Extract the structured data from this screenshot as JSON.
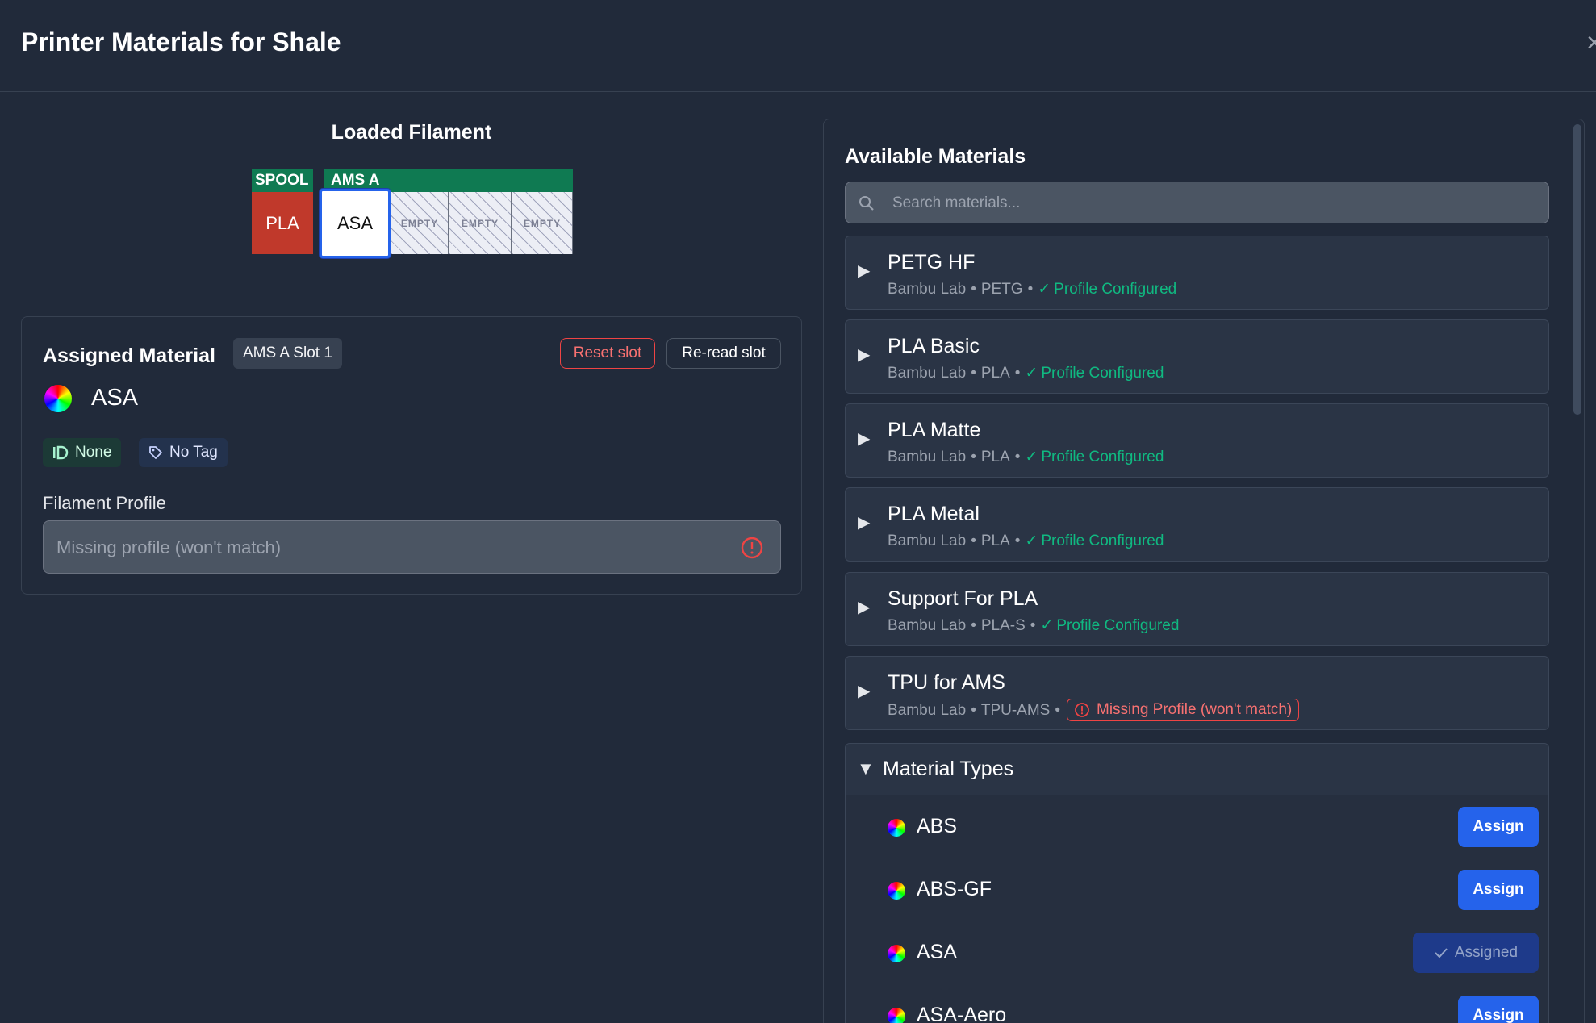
{
  "dialog": {
    "title": "Printer Materials for Shale",
    "close_glyph": "×"
  },
  "loaded_filament": {
    "title": "Loaded Filament",
    "spool_label": "SPOOL",
    "ams_label": "AMS A",
    "spool_slot": {
      "material": "PLA",
      "color": "#c0392b"
    },
    "ams_slots": [
      {
        "material": "ASA",
        "selected": true
      },
      {
        "material": "EMPTY"
      },
      {
        "material": "EMPTY"
      },
      {
        "material": "EMPTY"
      }
    ]
  },
  "assigned": {
    "title": "Assigned Material",
    "slot_badge": "AMS A Slot 1",
    "reset_label": "Reset slot",
    "reread_label": "Re-read slot",
    "material_name": "ASA",
    "id_pill": "None",
    "tag_pill": "No Tag",
    "profile_label": "Filament Profile",
    "profile_placeholder": "Missing profile (won't match)"
  },
  "available": {
    "title": "Available Materials",
    "search_placeholder": "Search materials...",
    "items": [
      {
        "name": "PETG HF",
        "brand": "Bambu Lab",
        "type": "PETG",
        "status": "Profile Configured",
        "ok": true
      },
      {
        "name": "PLA Basic",
        "brand": "Bambu Lab",
        "type": "PLA",
        "status": "Profile Configured",
        "ok": true
      },
      {
        "name": "PLA Matte",
        "brand": "Bambu Lab",
        "type": "PLA",
        "status": "Profile Configured",
        "ok": true
      },
      {
        "name": "PLA Metal",
        "brand": "Bambu Lab",
        "type": "PLA",
        "status": "Profile Configured",
        "ok": true
      },
      {
        "name": "Support For PLA",
        "brand": "Bambu Lab",
        "type": "PLA-S",
        "status": "Profile Configured",
        "ok": true
      },
      {
        "name": "TPU for AMS",
        "brand": "Bambu Lab",
        "type": "TPU-AMS",
        "status": "Missing Profile (won't match)",
        "ok": false
      }
    ],
    "separator": "•",
    "check_glyph": "✓",
    "expand_glyph": "▶",
    "collapse_glyph": "▼",
    "types_title": "Material Types",
    "types": [
      {
        "name": "ABS",
        "action": "Assign",
        "assigned": false
      },
      {
        "name": "ABS-GF",
        "action": "Assign",
        "assigned": false
      },
      {
        "name": "ASA",
        "action": "Assigned",
        "assigned": true
      },
      {
        "name": "ASA-Aero",
        "action": "Assign",
        "assigned": false
      }
    ]
  },
  "colors": {
    "accent": "#2563eb",
    "success": "#10b981",
    "danger": "#ef4444",
    "ams_label_bg": "#0f7a52"
  }
}
